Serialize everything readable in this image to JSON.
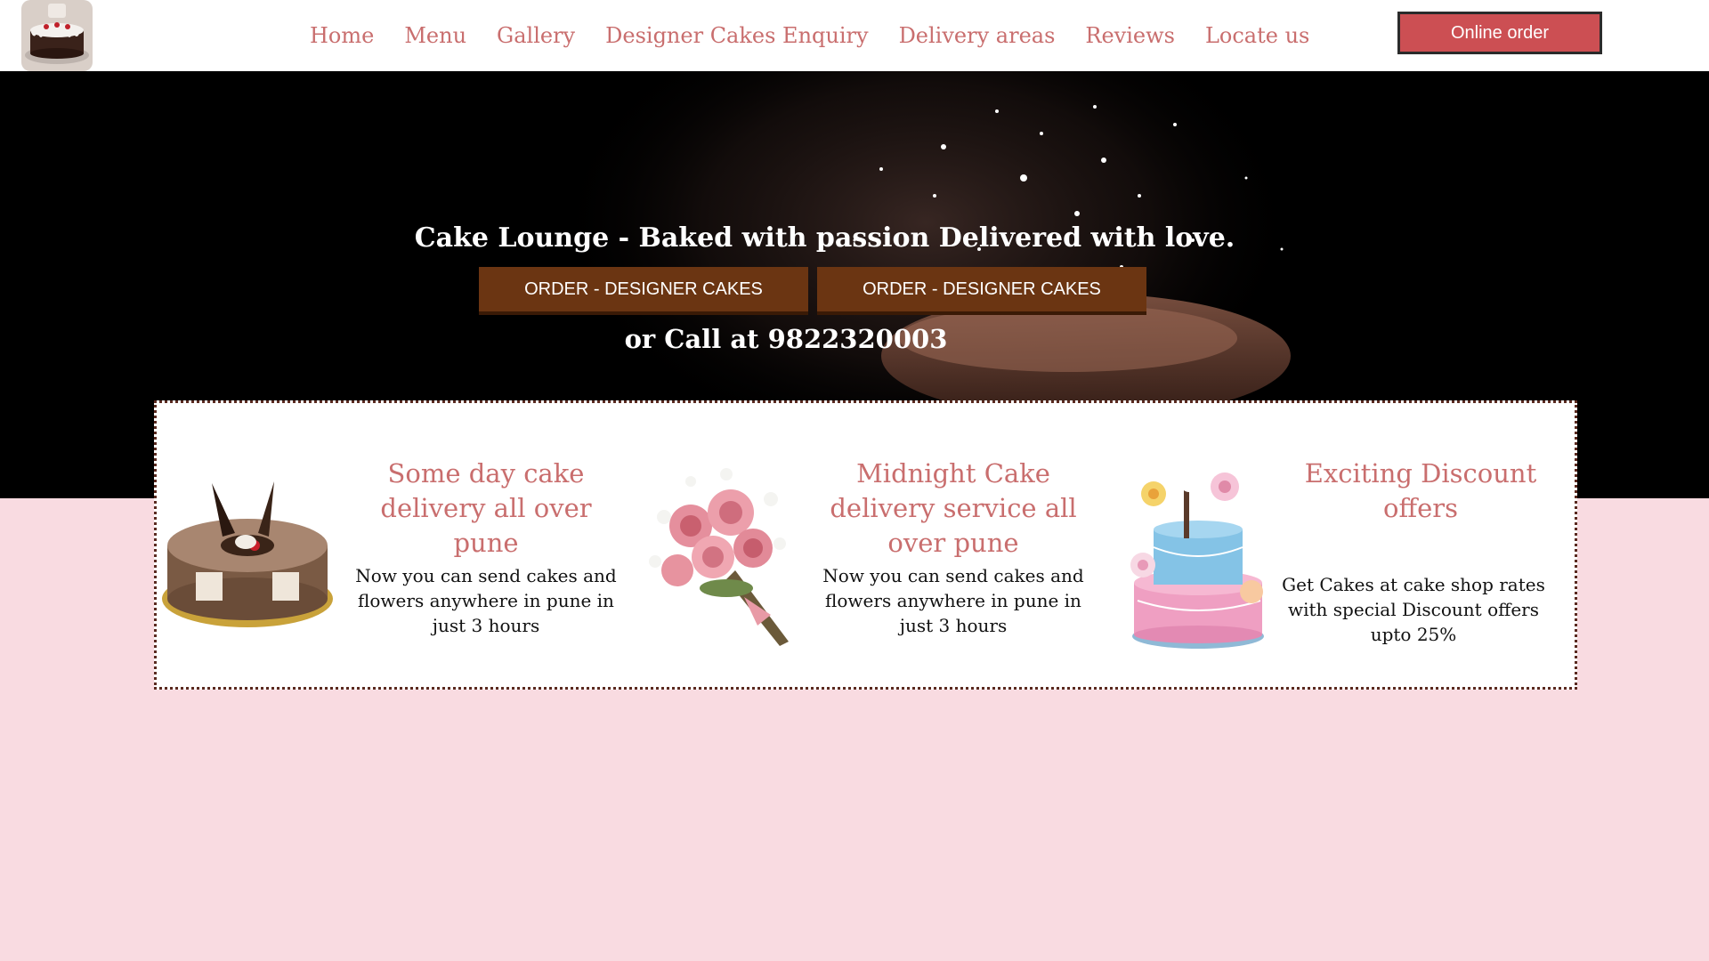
{
  "header": {
    "logo_icon": "cake-logo-icon",
    "nav": [
      {
        "label": "Home"
      },
      {
        "label": "Menu"
      },
      {
        "label": "Gallery"
      },
      {
        "label": "Designer Cakes Enquiry"
      },
      {
        "label": "Delivery areas"
      },
      {
        "label": "Reviews"
      },
      {
        "label": "Locate us"
      }
    ],
    "order_button": "Online order"
  },
  "hero": {
    "title": "Cake Lounge - Baked with passion Delivered with love.",
    "buttons": [
      "ORDER - DESIGNER CAKES",
      "ORDER - DESIGNER CAKES"
    ],
    "call_text": "or Call at 9822320003"
  },
  "features": [
    {
      "icon": "chocolate-ring-cake-image",
      "title": "Some day cake delivery all over pune",
      "text": "Now you can send cakes and flowers anywhere in pune in just 3 hours"
    },
    {
      "icon": "rose-bouquet-image",
      "title": "Midnight Cake delivery service all over pune",
      "text": "Now you can send cakes and flowers anywhere in pune in just 3 hours"
    },
    {
      "icon": "tiered-designer-cake-image",
      "title": "Exciting Discount offers",
      "text": "Get Cakes at cake shop rates with special Discount offers upto 25%"
    }
  ],
  "colors": {
    "accent": "#c96e6e",
    "order_button": "#cc4f53",
    "hero_button": "#6b3512",
    "page_bg": "#f9dbe1"
  }
}
